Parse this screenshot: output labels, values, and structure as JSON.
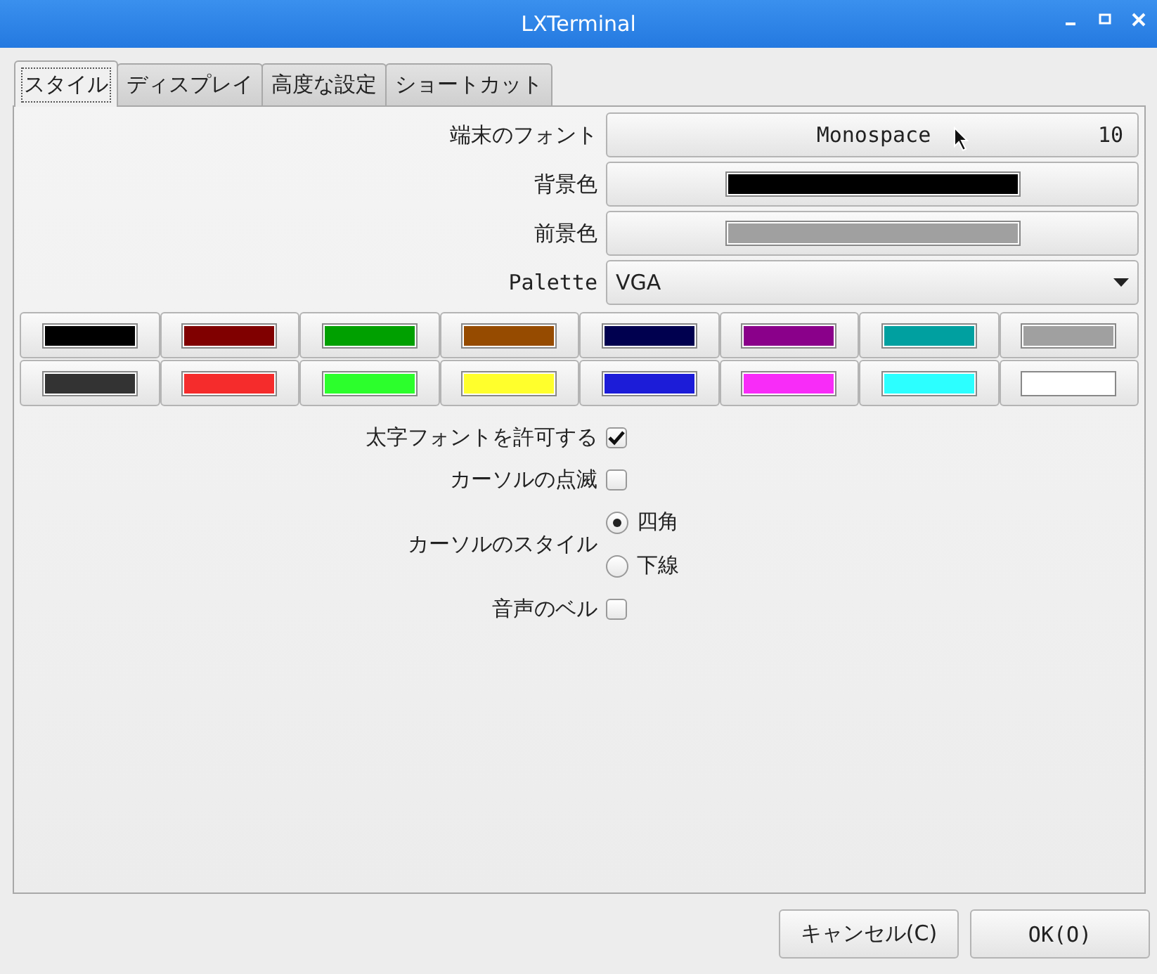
{
  "window": {
    "title": "LXTerminal"
  },
  "tabs": [
    {
      "label": "スタイル",
      "selected": true
    },
    {
      "label": "ディスプレイ",
      "selected": false
    },
    {
      "label": "高度な設定",
      "selected": false
    },
    {
      "label": "ショートカット",
      "selected": false
    }
  ],
  "font": {
    "label": "端末のフォント",
    "value": "Monospace",
    "size": "10"
  },
  "background": {
    "label": "背景色",
    "color": "#000000"
  },
  "foreground": {
    "label": "前景色",
    "color": "#a0a0a0"
  },
  "palette": {
    "label": "Palette",
    "value": "VGA",
    "colors": [
      {
        "color": "#000000"
      },
      {
        "color": "#800000"
      },
      {
        "color": "#00a000"
      },
      {
        "color": "#964b00"
      },
      {
        "color": "#00004f"
      },
      {
        "color": "#8a008a"
      },
      {
        "color": "#00a0a0"
      },
      {
        "color": "#a0a0a0"
      },
      {
        "color": "#333333"
      },
      {
        "color": "#f52c2c"
      },
      {
        "color": "#2cff2c"
      },
      {
        "color": "#ffff2c"
      },
      {
        "color": "#1c1cd8"
      },
      {
        "color": "#f82cf8"
      },
      {
        "color": "#2cffff"
      },
      {
        "color": "#ffffff"
      }
    ]
  },
  "options": [
    {
      "kind": "checkbox",
      "label": "太字フォントを許可する",
      "checked": true
    },
    {
      "kind": "checkbox",
      "label": "カーソルの点滅",
      "checked": false
    },
    {
      "kind": "radio",
      "label": "カーソルのスタイル",
      "choices": [
        {
          "label": "四角",
          "selected": true
        },
        {
          "label": "下線",
          "selected": false
        }
      ]
    },
    {
      "kind": "checkbox",
      "label": "音声のベル",
      "checked": false
    }
  ],
  "buttons": [
    "キャンセル(C)",
    "OK(O)"
  ]
}
